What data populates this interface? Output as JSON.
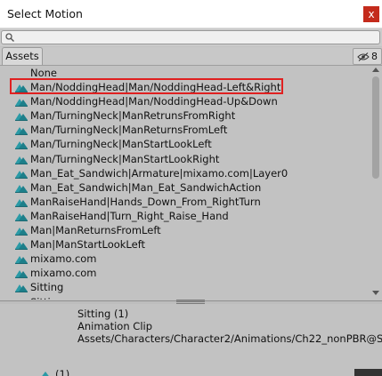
{
  "window": {
    "title": "Select Motion",
    "close_symbol": "x"
  },
  "search": {
    "value": "",
    "icon": "search-icon"
  },
  "tabs": {
    "assets_label": "Assets",
    "hidden_count": "8",
    "eye_icon": "eye-slash-icon"
  },
  "list": {
    "none_label": "None",
    "icon": "animation-clip-icon",
    "selected_index": 0,
    "items": [
      "Man/NoddingHead|Man/NoddingHead-Left&Right",
      "Man/NoddingHead|Man/NoddingHead-Up&Down",
      "Man/TurningNeck|ManRetrunsFromRight",
      "Man/TurningNeck|ManReturnsFromLeft",
      "Man/TurningNeck|ManStartLookLeft",
      "Man/TurningNeck|ManStartLookRight",
      "Man_Eat_Sandwich|Armature|mixamo.com|Layer0",
      "Man_Eat_Sandwich|Man_Eat_SandwichAction",
      "ManRaiseHand|Hands_Down_From_RightTurn",
      "ManRaiseHand|Turn_Right_Raise_Hand",
      "Man|ManReturnsFromLeft",
      "Man|ManStartLookLeft",
      "mixamo.com",
      "mixamo.com",
      "Sitting",
      "Sitting"
    ]
  },
  "info": {
    "name": "Sitting (1)",
    "type": "Animation Clip",
    "path": "Assets/Characters/Character2/Animations/Ch22_nonPBR@S"
  },
  "bottom_partial": {
    "text": "(1)"
  },
  "colors": {
    "icon_teal": "#2a9aa6",
    "highlight_red": "#e02020",
    "close_red": "#c42b1c"
  }
}
